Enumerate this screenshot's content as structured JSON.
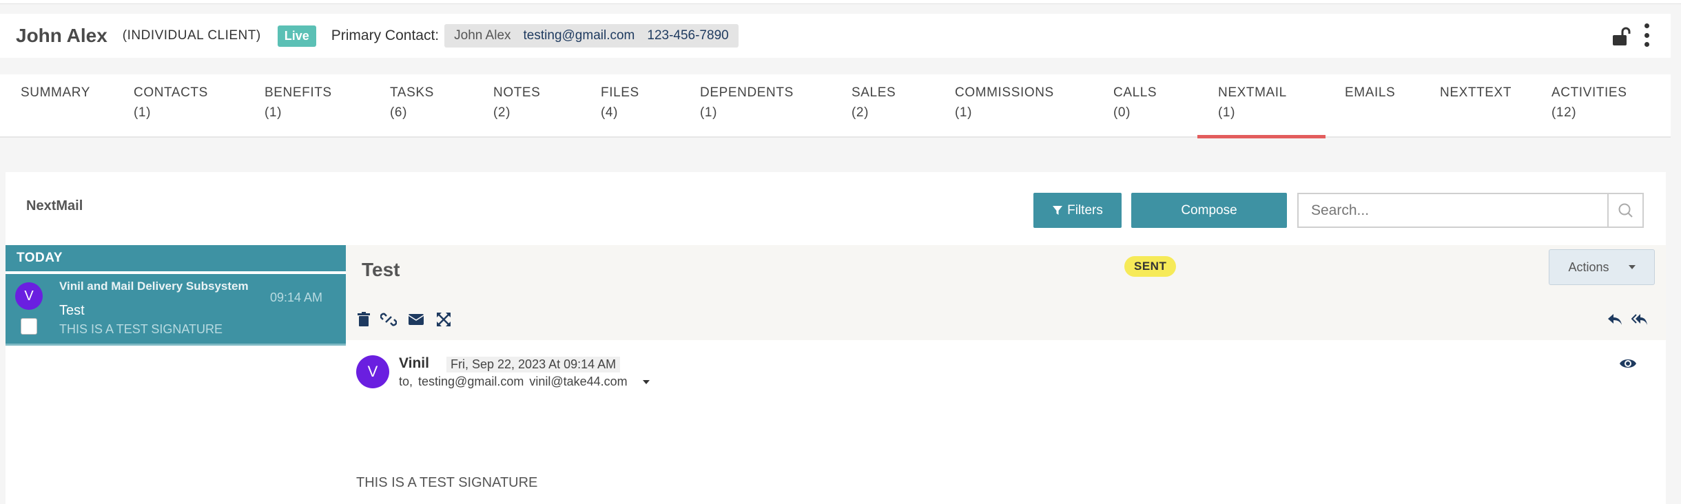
{
  "header": {
    "client_name": "John Alex",
    "client_type": "(INDIVIDUAL CLIENT)",
    "status_badge": "Live",
    "primary_contact_label": "Primary Contact:",
    "contact_name": "John Alex",
    "contact_email": "testing@gmail.com",
    "contact_phone": "123-456-7890"
  },
  "tabs": [
    {
      "label": "SUMMARY",
      "count": ""
    },
    {
      "label": "CONTACTS",
      "count": "(1)"
    },
    {
      "label": "BENEFITS",
      "count": "(1)"
    },
    {
      "label": "TASKS",
      "count": "(6)"
    },
    {
      "label": "NOTES",
      "count": "(2)"
    },
    {
      "label": "FILES",
      "count": "(4)"
    },
    {
      "label": "DEPENDENTS",
      "count": "(1)"
    },
    {
      "label": "SALES",
      "count": "(2)"
    },
    {
      "label": "COMMISSIONS",
      "count": "(1)"
    },
    {
      "label": "CALLS",
      "count": "(0)"
    },
    {
      "label": "NEXTMAIL",
      "count": "(1)"
    },
    {
      "label": "EMAILS",
      "count": ""
    },
    {
      "label": "NEXTTEXT",
      "count": ""
    },
    {
      "label": "ACTIVITIES",
      "count": "(12)"
    }
  ],
  "active_tab": "NEXTMAIL",
  "nextmail": {
    "title": "NextMail",
    "filters_label": "Filters",
    "compose_label": "Compose",
    "search_placeholder": "Search..."
  },
  "list": {
    "group_label": "TODAY",
    "items": [
      {
        "avatar": "V",
        "from": "Vinil and Mail Delivery Subsystem",
        "time": "09:14 AM",
        "subject": "Test",
        "snippet": "THIS IS A TEST SIGNATURE"
      }
    ]
  },
  "message": {
    "subject": "Test",
    "status": "SENT",
    "actions_label": "Actions",
    "sender_avatar": "V",
    "sender_name": "Vinil",
    "date": "Fri, Sep 22, 2023 At 09:14 AM",
    "to_label": "to,",
    "to_1": "testing@gmail.com",
    "to_2": "vinil@take44.com",
    "body": "THIS IS A TEST SIGNATURE"
  },
  "colors": {
    "accent": "#3e92a3",
    "live": "#5bc0b5",
    "active_tab_underline": "#e35d5d",
    "sent_badge": "#f6ea58",
    "avatar": "#6a1fe0"
  }
}
